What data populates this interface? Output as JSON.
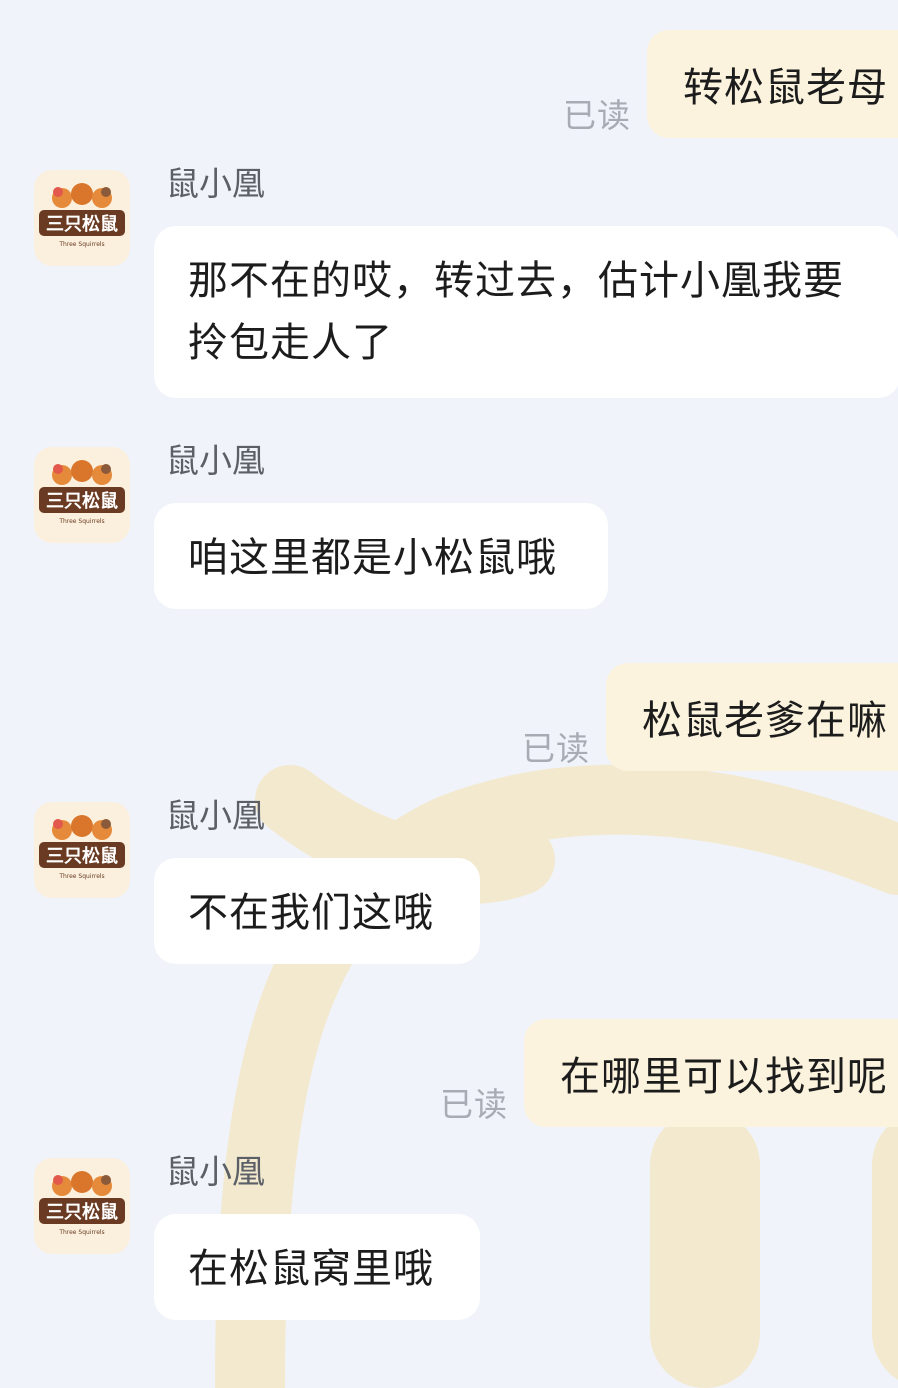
{
  "theme": {
    "background": "#f0f3f9",
    "my_bubble": "#fbf3de",
    "other_bubble": "#ffffff",
    "read_color": "#a7abb3",
    "watermark": "#f3e9cf"
  },
  "avatar": {
    "brand_text": "三只松鼠",
    "brand_sub": "Three Squirrels"
  },
  "messages": [
    {
      "from": "me",
      "text": "转松鼠老母",
      "status": "已读"
    },
    {
      "from": "other",
      "sender": "鼠小凰",
      "text": "那不在的哎，转过去，估计小凰我要拎包走人了"
    },
    {
      "from": "other",
      "sender": "鼠小凰",
      "text": "咱这里都是小松鼠哦"
    },
    {
      "from": "me",
      "text": "松鼠老爹在嘛",
      "status": "已读"
    },
    {
      "from": "other",
      "sender": "鼠小凰",
      "text": "不在我们这哦"
    },
    {
      "from": "me",
      "text": "在哪里可以找到呢",
      "status": "已读"
    },
    {
      "from": "other",
      "sender": "鼠小凰",
      "text": "在松鼠窝里哦"
    }
  ]
}
